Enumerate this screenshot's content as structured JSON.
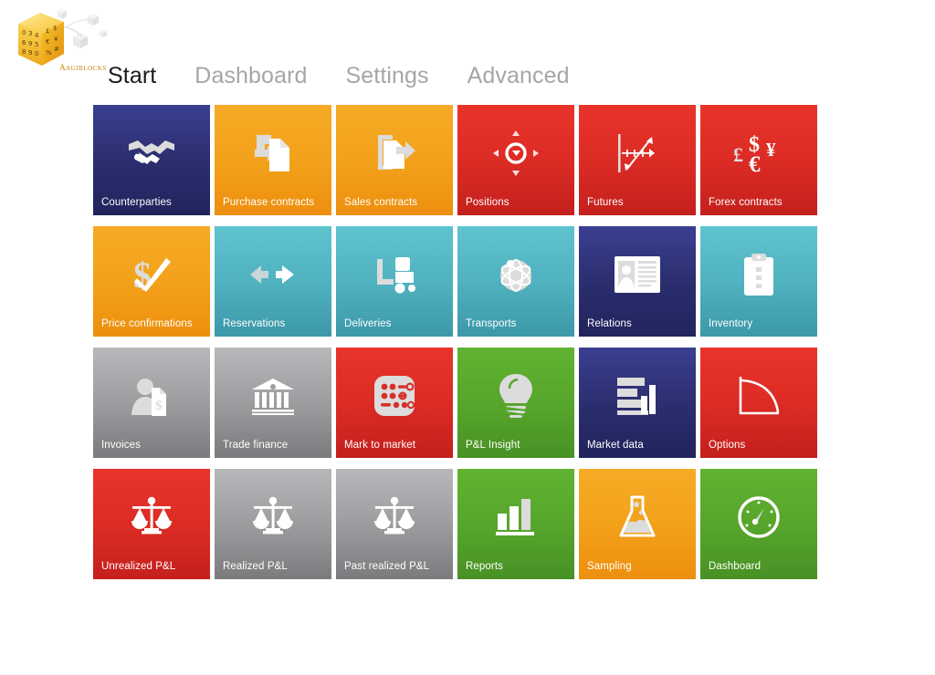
{
  "app": {
    "logo_text": "AGIBLOCKS",
    "logo_name": "agiblocks-cube-logo"
  },
  "nav": {
    "items": [
      {
        "label": "Start",
        "active": true
      },
      {
        "label": "Dashboard",
        "active": false
      },
      {
        "label": "Settings",
        "active": false
      },
      {
        "label": "Advanced",
        "active": false
      }
    ]
  },
  "colors": {
    "navy": "#2c2f70",
    "orange": "#f3a11a",
    "red": "#dc2c25",
    "teal": "#51b2c0",
    "gray": "#9d9da0",
    "green": "#57a62c",
    "nav_active": "#1b1b1b",
    "nav_inactive": "#a6a6a6",
    "tile_label": "#ffffff",
    "background": "#ffffff"
  },
  "tiles": [
    {
      "label": "Counterparties",
      "color": "navy",
      "icon": "handshake-icon"
    },
    {
      "label": "Purchase contracts",
      "color": "orange",
      "icon": "document-arrow-in-icon"
    },
    {
      "label": "Sales contracts",
      "color": "orange",
      "icon": "document-arrow-out-icon"
    },
    {
      "label": "Positions",
      "color": "red",
      "icon": "compass-move-icon"
    },
    {
      "label": "Futures",
      "color": "red",
      "icon": "trend-axis-icon"
    },
    {
      "label": "Forex contracts",
      "color": "red",
      "icon": "currency-symbols-icon"
    },
    {
      "label": "Price confirmations",
      "color": "orange",
      "icon": "dollar-check-icon"
    },
    {
      "label": "Reservations",
      "color": "teal",
      "icon": "two-arrows-icon"
    },
    {
      "label": "Deliveries",
      "color": "teal",
      "icon": "forklift-icon"
    },
    {
      "label": "Transports",
      "color": "teal",
      "icon": "globe-network-icon"
    },
    {
      "label": "Relations",
      "color": "navy",
      "icon": "contact-card-icon"
    },
    {
      "label": "Inventory",
      "color": "teal",
      "icon": "clipboard-icon"
    },
    {
      "label": "Invoices",
      "color": "gray",
      "icon": "person-invoice-icon"
    },
    {
      "label": "Trade finance",
      "color": "gray",
      "icon": "bank-icon"
    },
    {
      "label": "Mark to market",
      "color": "red",
      "icon": "calculator-icon"
    },
    {
      "label": "P&L Insight",
      "color": "green",
      "icon": "lightbulb-icon"
    },
    {
      "label": "Market data",
      "color": "navy",
      "icon": "chart-bars-icon"
    },
    {
      "label": "Options",
      "color": "red",
      "icon": "curve-graph-icon"
    },
    {
      "label": "Unrealized P&L",
      "color": "red",
      "icon": "scales-icon"
    },
    {
      "label": "Realized P&L",
      "color": "gray",
      "icon": "scales-icon"
    },
    {
      "label": "Past realized P&L",
      "color": "gray",
      "icon": "scales-icon"
    },
    {
      "label": "Reports",
      "color": "green",
      "icon": "bar-chart-icon"
    },
    {
      "label": "Sampling",
      "color": "orange",
      "icon": "flask-icon"
    },
    {
      "label": "Dashboard",
      "color": "green",
      "icon": "gauge-icon"
    }
  ]
}
